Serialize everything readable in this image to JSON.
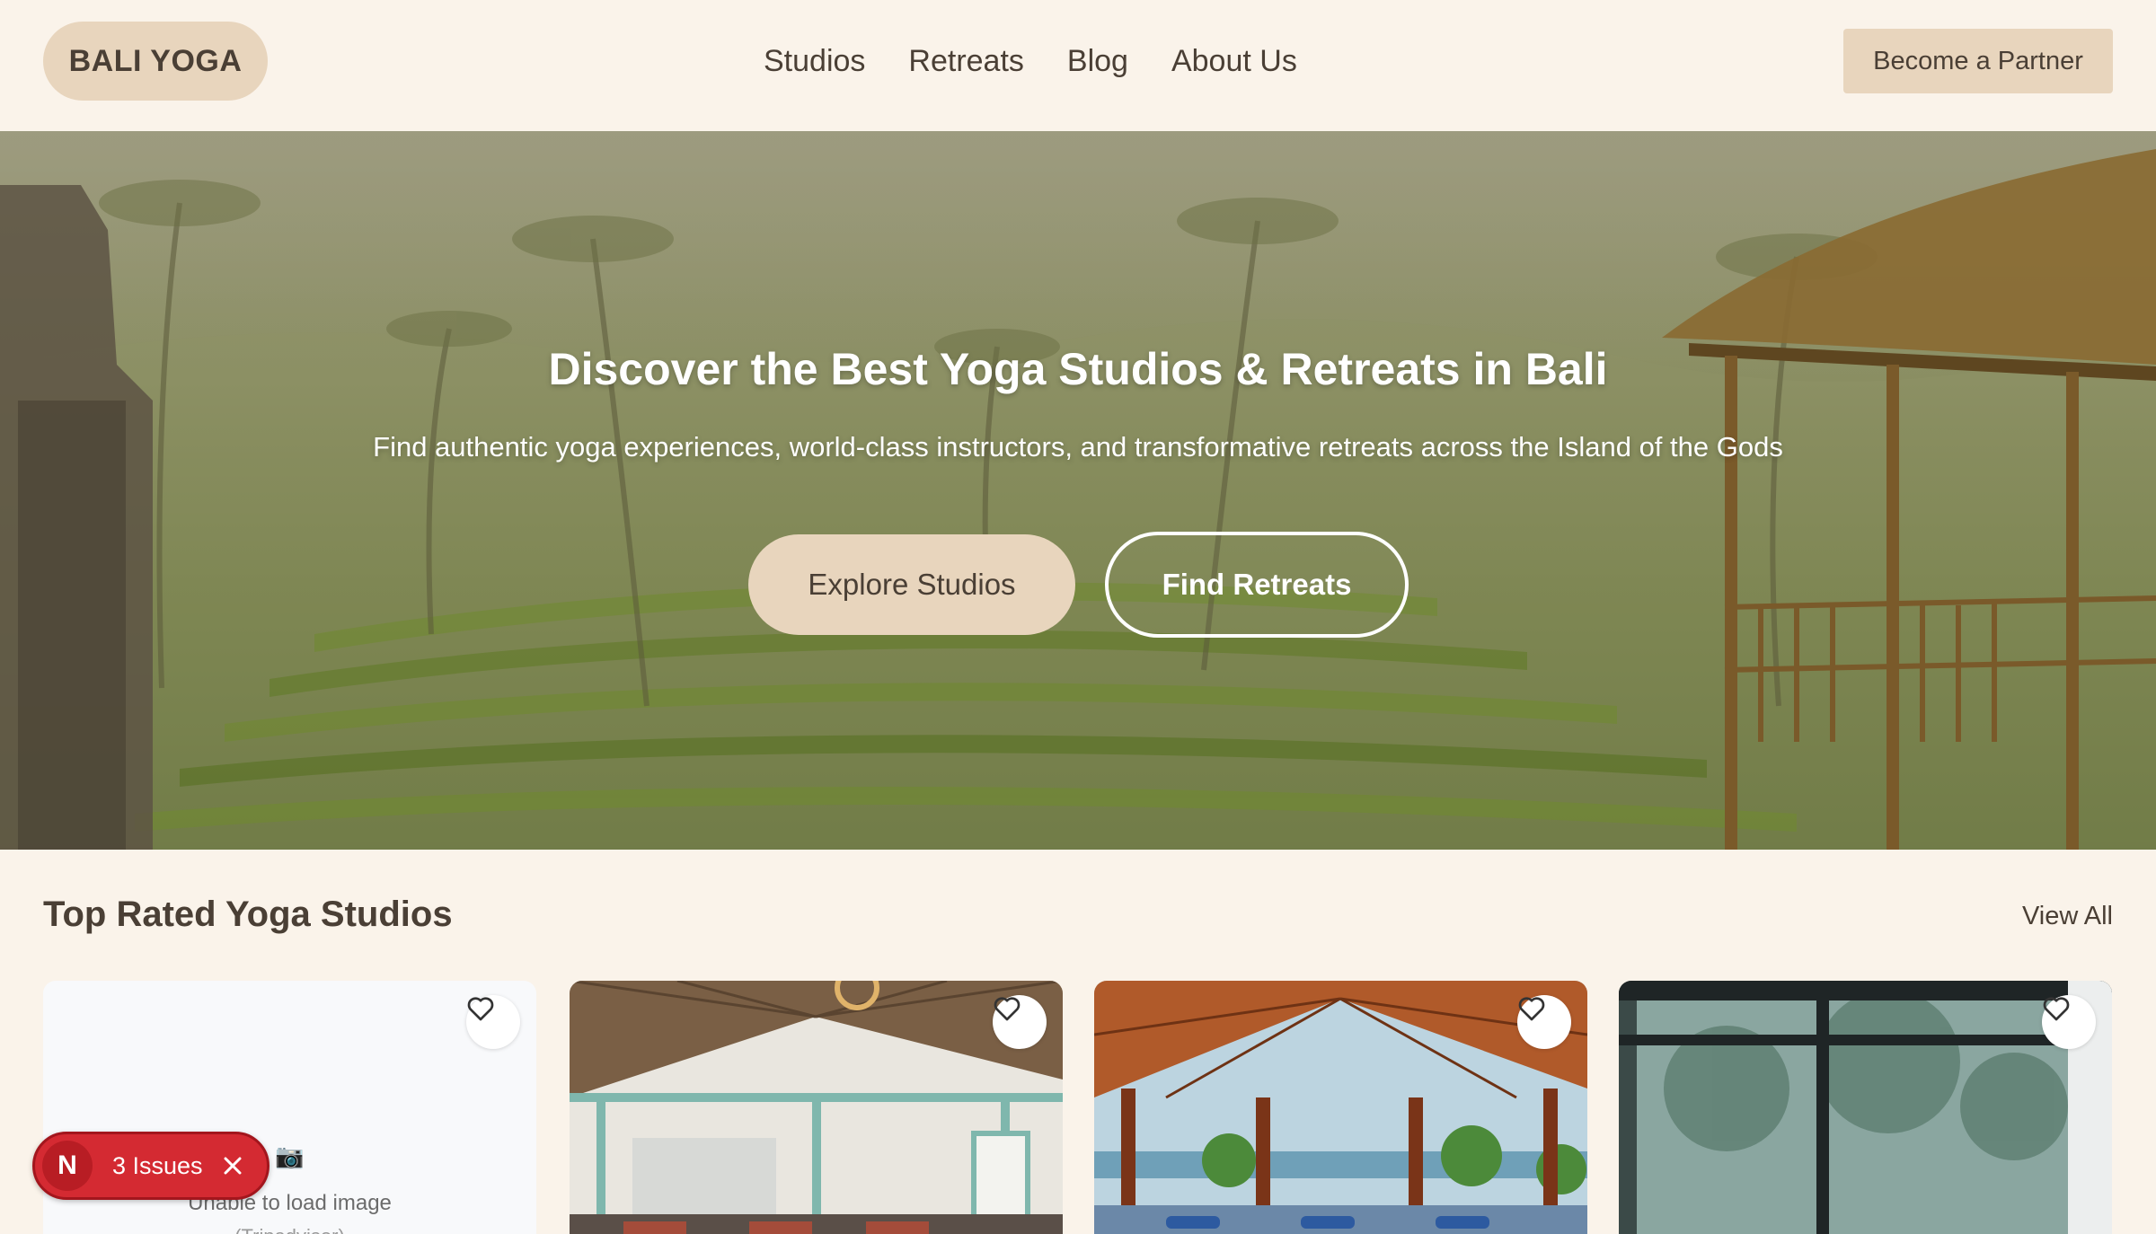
{
  "header": {
    "logo": "BALI YOGA",
    "nav": [
      "Studios",
      "Retreats",
      "Blog",
      "About Us"
    ],
    "partner_button": "Become a Partner"
  },
  "hero": {
    "title": "Discover the Best Yoga Studios & Retreats in Bali",
    "subtitle": "Find authentic yoga experiences, world-class instructors, and transformative retreats across the Island of the Gods",
    "primary_button": "Explore Studios",
    "secondary_button": "Find Retreats"
  },
  "studios": {
    "title": "Top Rated Yoga Studios",
    "view_all": "View All",
    "image_error": {
      "icon": "📷",
      "text": "Unable to load image",
      "subtext": "(Tripadvisor)"
    },
    "cards": [
      {
        "favorite_icon": "heart-icon"
      },
      {
        "favorite_icon": "heart-icon"
      },
      {
        "favorite_icon": "heart-icon"
      },
      {
        "favorite_icon": "heart-icon"
      }
    ]
  },
  "issues_badge": {
    "avatar_letter": "N",
    "label": "3 Issues"
  },
  "colors": {
    "background": "#faf3ea",
    "accent": "#e8d5bd",
    "text": "#4a3f35",
    "issues_red": "#d42a32"
  }
}
